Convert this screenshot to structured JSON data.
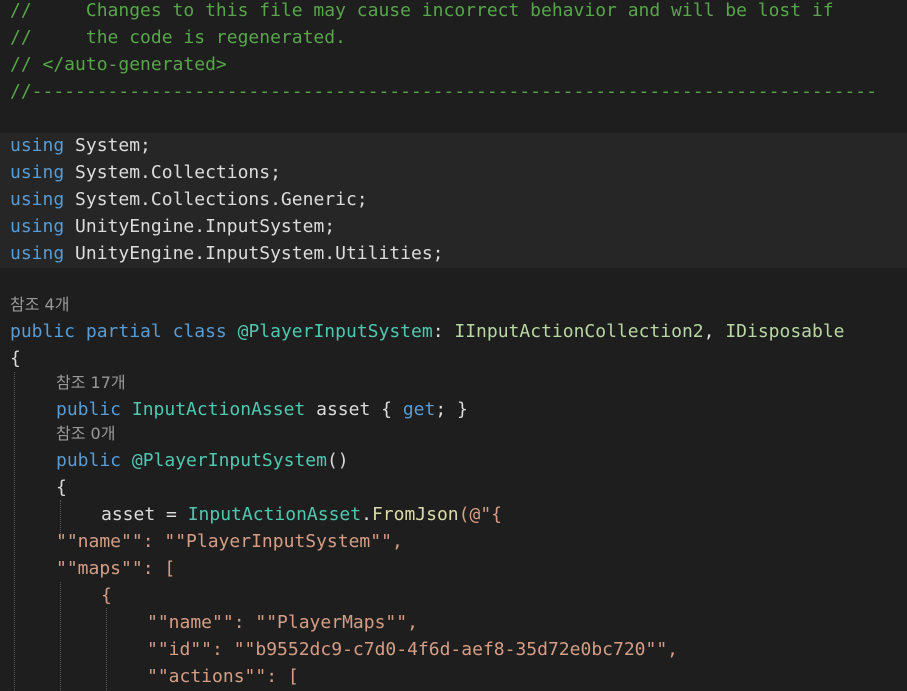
{
  "header_comments": [
    "//     Changes to this file may cause incorrect behavior and will be lost if",
    "//     the code is regenerated.",
    "// </auto-generated>",
    "//------------------------------------------------------------------------------"
  ],
  "usings": {
    "keyword": "using",
    "namespaces": [
      "System;",
      "System.Collections;",
      "System.Collections.Generic;",
      "UnityEngine.InputSystem;",
      "UnityEngine.InputSystem.Utilities;"
    ]
  },
  "codelens": {
    "class_refs": "참조 4개",
    "asset_refs": "참조 17개",
    "ctor_refs": "참조 0개"
  },
  "class_decl": {
    "kw_public": "public",
    "kw_partial": "partial",
    "kw_class": "class",
    "name": "@PlayerInputSystem",
    "colon": ": ",
    "iface1": "IInputActionCollection2",
    "comma": ", ",
    "iface2": "IDisposable"
  },
  "open_brace": "{",
  "asset_prop": {
    "kw_public": "public",
    "type": "InputActionAsset",
    "name": " asset { ",
    "kw_get": "get",
    "rest": "; }"
  },
  "ctor": {
    "kw_public": "public",
    "name": "@PlayerInputSystem",
    "parens": "()"
  },
  "ctor_open_brace": "{",
  "asset_assign": {
    "lhs": "asset = ",
    "type": "InputActionAsset",
    "dot": ".",
    "method": "FromJson",
    "tail": "(@\"{"
  },
  "json_lines": [
    "\"\"name\"\": \"\"PlayerInputSystem\"\",",
    "\"\"maps\"\": [",
    "{",
    "\"\"name\"\": \"\"PlayerMaps\"\",",
    "\"\"id\"\": \"\"b9552dc9-c7d0-4f6d-aef8-35d72e0bc720\"\",",
    "\"\"actions\"\": ["
  ],
  "colors": {
    "background": "#1e1e1e",
    "comment": "#57a64a",
    "keyword": "#569cd6",
    "type": "#4ec9b0",
    "interface": "#b8d7a3",
    "method": "#dcdcaa",
    "string": "#d69d85",
    "text": "#dcdcdc",
    "codelens": "#999999"
  }
}
